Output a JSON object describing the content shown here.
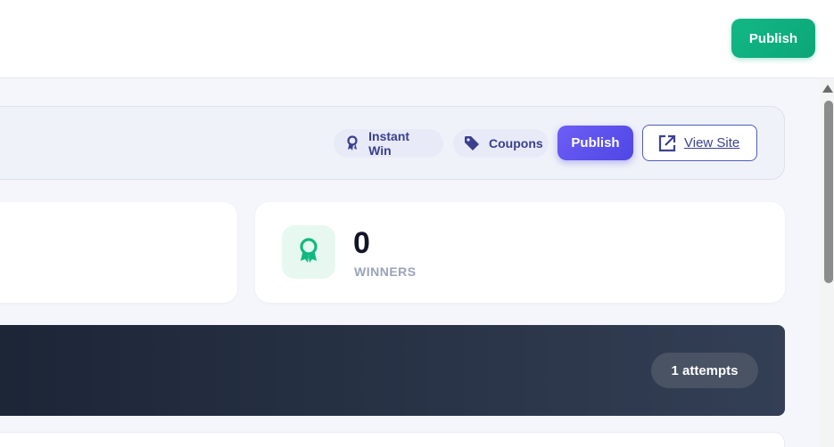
{
  "header": {
    "publish_label": "Publish"
  },
  "toolbar": {
    "instant_win_label": "Instant Win",
    "coupons_label": "Coupons",
    "publish_label": "Publish",
    "view_site_label": "View Site",
    "icons": {
      "instant_win": "award-ribbon-icon",
      "coupons": "tag-icon",
      "view_site": "external-link-icon"
    }
  },
  "stats": {
    "winners": {
      "value": "0",
      "label": "WINNERS",
      "icon": "award-ribbon-icon"
    }
  },
  "banner": {
    "attempts_label": "1 attempts"
  },
  "colors": {
    "green_accent": "#10b981",
    "indigo_accent": "#4f46e5",
    "dark_banner": "#1c2536"
  }
}
